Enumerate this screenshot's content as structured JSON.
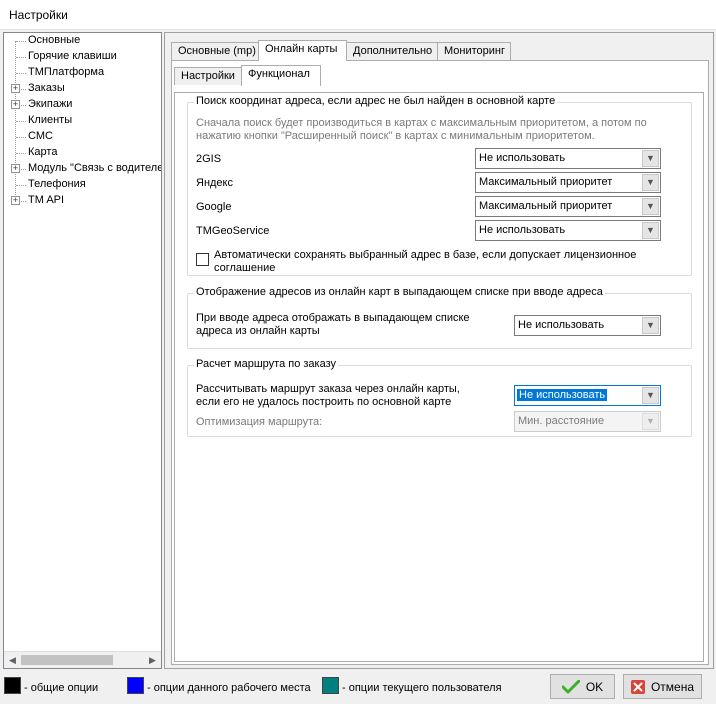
{
  "window": {
    "title": "Настройки"
  },
  "tree": {
    "items": [
      {
        "label": "Основные",
        "expandable": false
      },
      {
        "label": "Горячие клавиши",
        "expandable": false
      },
      {
        "label": "ТМПлатформа",
        "expandable": false
      },
      {
        "label": "Заказы",
        "expandable": true
      },
      {
        "label": "Экипажи",
        "expandable": true
      },
      {
        "label": "Клиенты",
        "expandable": false
      },
      {
        "label": "СМС",
        "expandable": false
      },
      {
        "label": "Карта",
        "expandable": false,
        "selected": true
      },
      {
        "label": "Модуль \"Связь с водителем\"",
        "expandable": true
      },
      {
        "label": "Телефония",
        "expandable": false
      },
      {
        "label": "TM API",
        "expandable": true
      }
    ]
  },
  "tabs": {
    "top": [
      "Основные (mp)",
      "Онлайн карты",
      "Дополнительно",
      "Мониторинг"
    ],
    "top_active": 1,
    "sub": [
      "Настройки",
      "Функционал"
    ],
    "sub_active": 1
  },
  "group1": {
    "title": "Поиск координат адреса, если адрес не был найден в основной карте",
    "hint_line1": "Сначала поиск будет производиться в картах с максимальным приоритетом, а потом по",
    "hint_line2": "нажатию кнопки \"Расширенный поиск\" в картах с минимальным приоритетом.",
    "rows": [
      {
        "label": "2GIS",
        "value": "Не использовать"
      },
      {
        "label": "Яндекс",
        "value": "Максимальный приоритет"
      },
      {
        "label": "Google",
        "value": "Максимальный приоритет"
      },
      {
        "label": "TMGeoService",
        "value": "Не использовать"
      }
    ],
    "checkbox_line1": "Автоматически сохранять выбранный адрес в базе, если допускает лицензионное",
    "checkbox_line2": "соглашение"
  },
  "group2": {
    "title": "Отображение адресов из онлайн карт в выпадающем списке при вводе адреса",
    "label_line1": "При вводе адреса отображать в выпадающем списке",
    "label_line2": "адреса из онлайн карты",
    "value": "Не использовать"
  },
  "group3": {
    "title": "Расчет маршрута по заказу",
    "label_line1": "Рассчитывать маршрут заказа через онлайн карты,",
    "label_line2": "если его не удалось построить по основной карте",
    "value": "Не использовать",
    "opt_label": "Оптимизация маршрута:",
    "opt_value": "Мин. расстояние"
  },
  "legend": [
    {
      "label": "- общие опции",
      "color": "#000000"
    },
    {
      "label": "- опции данного рабочего места",
      "color": "#0000ff"
    },
    {
      "label": "- опции текущего пользователя",
      "color": "#008080"
    }
  ],
  "buttons": {
    "ok": "OK",
    "cancel": "Отмена"
  }
}
